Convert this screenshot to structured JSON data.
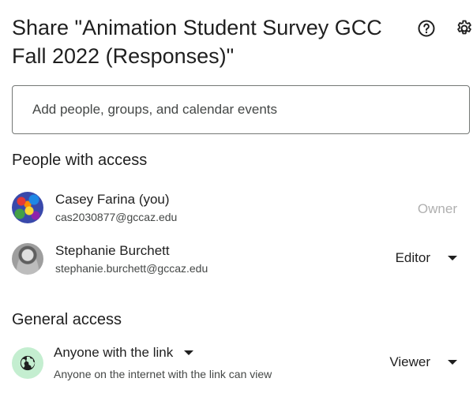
{
  "dialog": {
    "title": "Share \"Animation Student Survey GCC Fall 2022 (Responses)\"",
    "help_icon": "help-circle-icon",
    "settings_icon": "gear-icon"
  },
  "add_people": {
    "placeholder": "Add people, groups, and calendar events"
  },
  "people_with_access": {
    "heading": "People with access",
    "people": [
      {
        "name": "Casey Farina (you)",
        "email": "cas2030877@gccaz.edu",
        "role": "Owner"
      },
      {
        "name": "Stephanie Burchett",
        "email": "stephanie.burchett@gccaz.edu",
        "role": "Editor"
      }
    ]
  },
  "general_access": {
    "heading": "General access",
    "icon": "globe-icon",
    "access_level": "Anyone with the link",
    "description": "Anyone on the internet with the link can view",
    "role": "Viewer"
  },
  "colors": {
    "globe_bg": "#c4eed0",
    "owner_text": "#b0b0b0"
  }
}
